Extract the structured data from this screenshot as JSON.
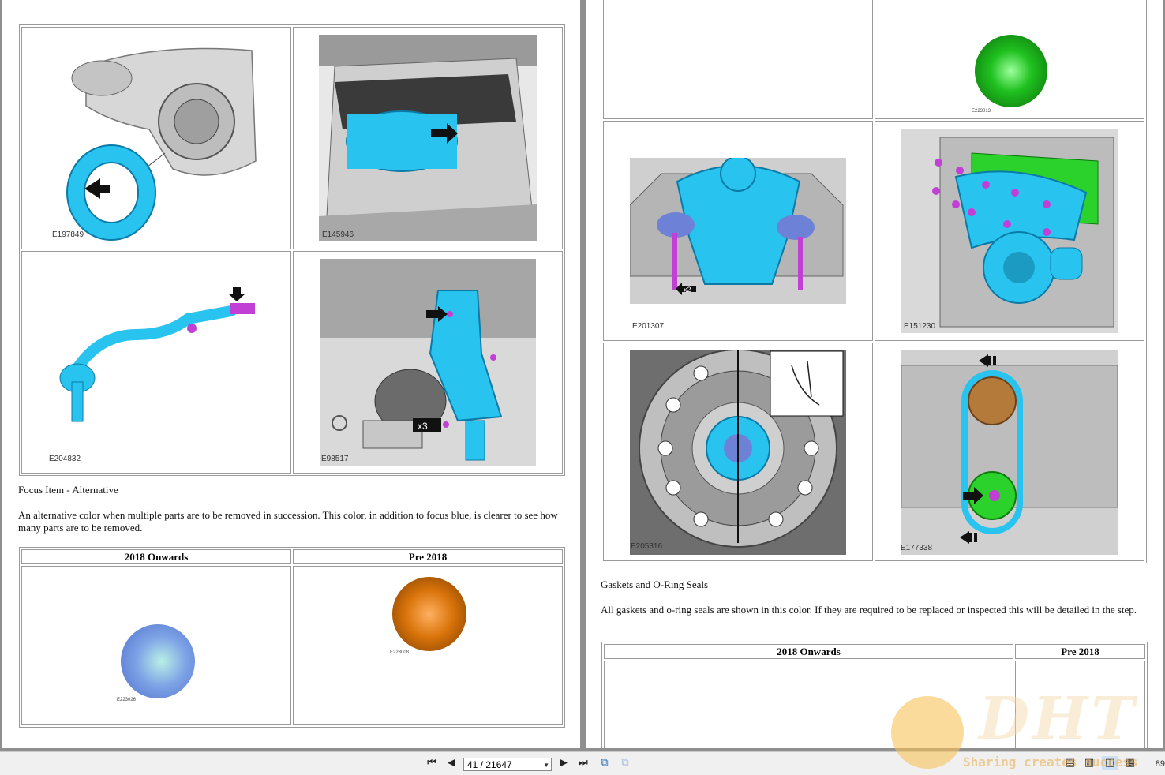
{
  "left_page": {
    "figures": [
      {
        "label": "E197849",
        "subject": "bushing and seal"
      },
      {
        "label": "E145946",
        "subject": "spare wheel in cargo area"
      },
      {
        "label": "E204832",
        "subject": "steering tie rod"
      },
      {
        "label": "E98517",
        "subject": "pedal box"
      }
    ],
    "section_title": "Focus Item - Alternative",
    "section_text": "An alternative color when multiple parts are to be removed in succession. This color, in addition to focus blue, is clearer to see how many parts are to be removed.",
    "color_table": {
      "col1_header": "2018 Onwards",
      "col2_header": "Pre 2018",
      "col1_swatch_label": "E223026",
      "col2_swatch_label": "E223008",
      "col1_color": "#7ea3e6",
      "col2_color": "#d9740a"
    }
  },
  "right_page": {
    "top_swatch_label": "E223013",
    "top_swatch_color": "#1fc11f",
    "figures": [
      {
        "label": "E201307",
        "subject": "engine mount bracket",
        "badge": "x2"
      },
      {
        "label": "E151230",
        "subject": "turbocharger and exhaust manifold"
      },
      {
        "label": "E205316",
        "subject": "crankshaft pulley"
      },
      {
        "label": "E177338",
        "subject": "timing chain"
      }
    ],
    "section_title": "Gaskets and O-Ring Seals",
    "section_text": "All gaskets and o-ring seals are shown in this color. If they are required to be replaced or inspected this will be detailed in the step.",
    "color_table": {
      "col1_header": "2018 Onwards",
      "col2_header": "Pre 2018"
    }
  },
  "toolbar": {
    "page_value": "41 / 21647",
    "zoom": "89",
    "icons": [
      "first-page-icon",
      "prev-page-icon",
      "next-page-icon",
      "last-page-icon",
      "prev-view-icon",
      "next-view-icon"
    ]
  },
  "badges": {
    "x3": "x3"
  },
  "watermark": {
    "logo": "DHT",
    "tagline": "Sharing creates success"
  },
  "colors": {
    "focus_blue": "#29c3f0",
    "magenta": "#c23fd6",
    "border": "#9a9a9a"
  }
}
